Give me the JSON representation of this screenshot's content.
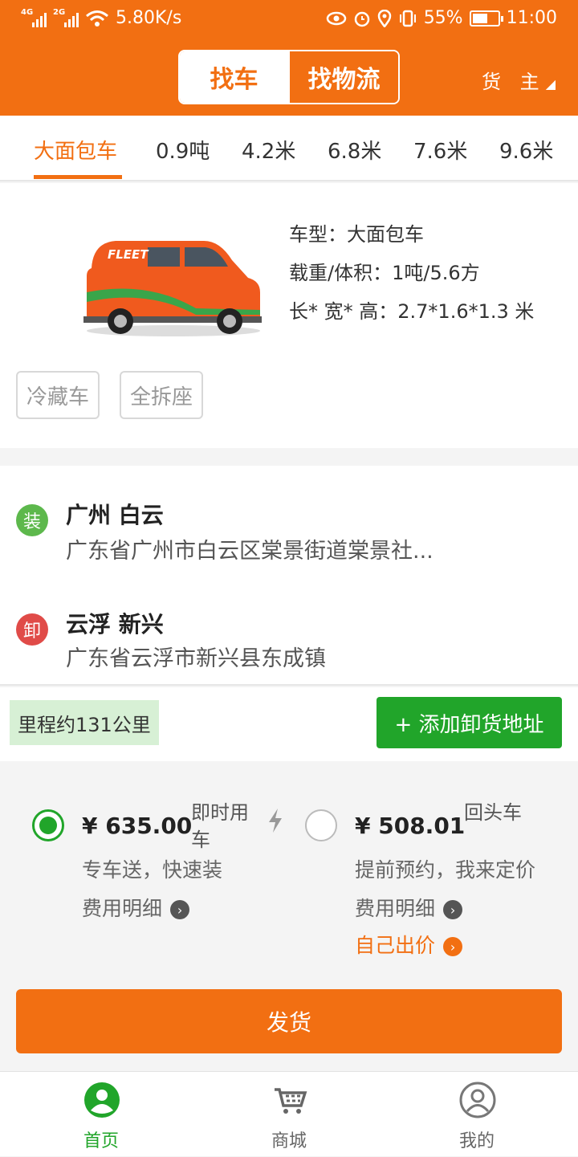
{
  "status_bar": {
    "network1": "4G",
    "network2": "2G",
    "speed": "5.80K/s",
    "battery": "55%",
    "time": "11:00"
  },
  "header": {
    "tab_active": "找车",
    "tab_inactive": "找物流",
    "role": "货 主"
  },
  "vehicle_tabs": [
    "大面包车",
    "0.9吨",
    "4.2米",
    "6.8米",
    "7.6米",
    "9.6米"
  ],
  "vehicle": {
    "type_label": "车型：大面包车",
    "load_label": "载重/体积：1吨/5.6方",
    "size_label": "长* 宽* 高：2.7*1.6*1.3 米",
    "options": [
      "冷藏车",
      "全拆座"
    ]
  },
  "route": {
    "load_badge": "装",
    "load_city": "广州 白云",
    "load_address": "广东省广州市白云区棠景街道棠景社...",
    "unload_badge": "卸",
    "unload_city": "云浮 新兴",
    "unload_address": "广东省云浮市新兴县东成镇"
  },
  "distance_label": "里程约131公里",
  "add_unload_button": "+ 添加卸货地址",
  "pricing": {
    "instant": {
      "price": "¥ 635.00",
      "tag_line1": "即时用",
      "tag_line2": "车",
      "desc": "专车送，快速装",
      "detail": "费用明细",
      "selected": true
    },
    "return": {
      "price": "¥ 508.01",
      "tag": "回头车",
      "desc": "提前预约，我来定价",
      "detail": "费用明细",
      "bid": "自己出价",
      "selected": false
    }
  },
  "ship_button": "发货",
  "bottom_nav": [
    {
      "label": "首页",
      "icon": "user-home-icon",
      "active": true
    },
    {
      "label": "商城",
      "icon": "cart-icon",
      "active": false
    },
    {
      "label": "我的",
      "icon": "profile-icon",
      "active": false
    }
  ],
  "colors": {
    "brand": "#f26f12",
    "green": "#21a52a",
    "unload_red": "#e04b48"
  }
}
